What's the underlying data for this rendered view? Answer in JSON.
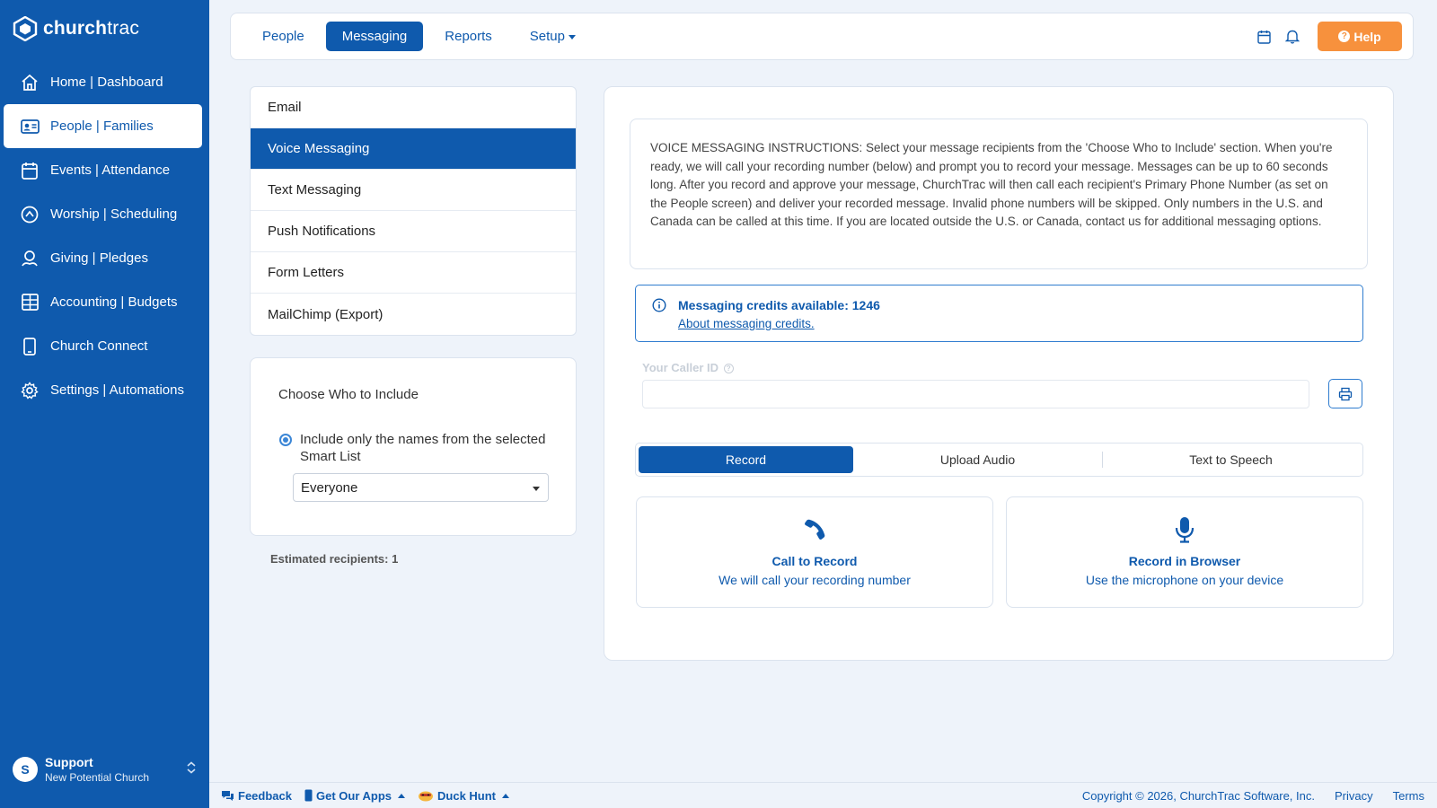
{
  "brand": {
    "name": "churchtrac"
  },
  "sidebar": {
    "items": [
      {
        "label": "Home | Dashboard",
        "icon": "home-icon"
      },
      {
        "label": "People | Families",
        "icon": "id-card-icon",
        "active": true
      },
      {
        "label": "Events | Attendance",
        "icon": "calendar-icon"
      },
      {
        "label": "Worship | Scheduling",
        "icon": "worship-icon"
      },
      {
        "label": "Giving | Pledges",
        "icon": "giving-icon"
      },
      {
        "label": "Accounting | Budgets",
        "icon": "grid-icon"
      },
      {
        "label": "Church Connect",
        "icon": "phone-icon"
      },
      {
        "label": "Settings | Automations",
        "icon": "gear-icon"
      }
    ],
    "user": {
      "initial": "S",
      "name": "Support",
      "org": "New Potential Church"
    }
  },
  "topbar": {
    "tabs": [
      {
        "label": "People"
      },
      {
        "label": "Messaging",
        "active": true
      },
      {
        "label": "Reports"
      },
      {
        "label": "Setup"
      }
    ],
    "help_label": "Help"
  },
  "messaging_menu": {
    "items": [
      {
        "label": "Email"
      },
      {
        "label": "Voice Messaging",
        "active": true
      },
      {
        "label": "Text Messaging"
      },
      {
        "label": "Push Notifications"
      },
      {
        "label": "Form Letters"
      },
      {
        "label": "MailChimp (Export)"
      }
    ]
  },
  "include": {
    "title": "Choose Who to Include",
    "radio_label": "Include only the names from the selected Smart List",
    "smart_list_value": "Everyone",
    "estimated": "Estimated recipients: 1"
  },
  "voice": {
    "instructions": "VOICE MESSAGING INSTRUCTIONS: Select your message recipients from the 'Choose Who to Include' section. When you're ready, we will call your recording number (below) and prompt you to record your message. Messages can be up to 60 seconds long. After you record and approve your message, ChurchTrac will then call each recipient's Primary Phone Number (as set on the People screen) and deliver your recorded message. Invalid phone numbers will be skipped. Only numbers in the U.S. and Canada can be called at this time. If you are located outside the U.S. or Canada, contact us for additional messaging options.",
    "credits_title": "Messaging credits available: 1246",
    "credits_link": "About messaging credits.",
    "caller_id_label": "Your Caller ID",
    "modes": [
      {
        "label": "Record",
        "active": true
      },
      {
        "label": "Upload Audio"
      },
      {
        "label": "Text to Speech"
      }
    ],
    "options": [
      {
        "title": "Call to Record",
        "sub": "We will call your recording number",
        "icon": "phone-icon"
      },
      {
        "title": "Record in Browser",
        "sub": "Use the microphone on your device",
        "icon": "microphone-icon"
      }
    ]
  },
  "footer": {
    "feedback": "Feedback",
    "apps": "Get Our Apps",
    "duck": "Duck Hunt",
    "copyright": "Copyright © 2026, ChurchTrac Software, Inc.",
    "privacy": "Privacy",
    "terms": "Terms"
  },
  "colors": {
    "primary": "#0f5aad",
    "accent": "#f7913d",
    "background": "#eef3fa"
  }
}
